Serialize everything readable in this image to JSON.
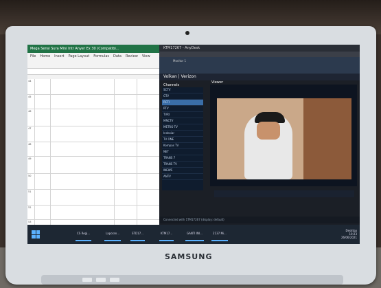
{
  "photo": {
    "description_visible_text": "",
    "laptop_brand": "SAMSUNG"
  },
  "excel": {
    "title": "Mega Sensi Sura Mini Intr Anyer Ex 30 (Compatibi...",
    "ribbon_tabs": [
      "File",
      "Home",
      "Insert",
      "Page Layout",
      "Formulas",
      "Data",
      "Review",
      "View"
    ],
    "row_numbers": [
      "44",
      "45",
      "46",
      "47",
      "48",
      "49",
      "50",
      "51",
      "52",
      "53"
    ]
  },
  "tv": {
    "title": "KTM17267 - AnyDesk",
    "tab": "Monitor 1",
    "header": "Volkan | Verizon",
    "panel_channels": "Channels",
    "panel_viewer": "Viewer",
    "status": "Connected with 1TM17267 (display: default)",
    "channels": [
      "SCTV",
      "GTV",
      "RCTI",
      "RTV",
      "TVRI",
      "MNCTV",
      "METRO TV",
      "Indosiar",
      "TV ONE",
      "Kompas TV",
      "NET",
      "TRANS 7",
      "TRANS TV",
      "INEWS",
      "ANTV"
    ]
  },
  "taskbar": {
    "items": [
      "CS Regi...",
      "Laporan...",
      "STD17...",
      "KTM17...",
      "GANTI INI...",
      "2137 Mi..."
    ],
    "tray_time": "10:23",
    "tray_date": "26/06/2021",
    "search": "Desktop"
  }
}
